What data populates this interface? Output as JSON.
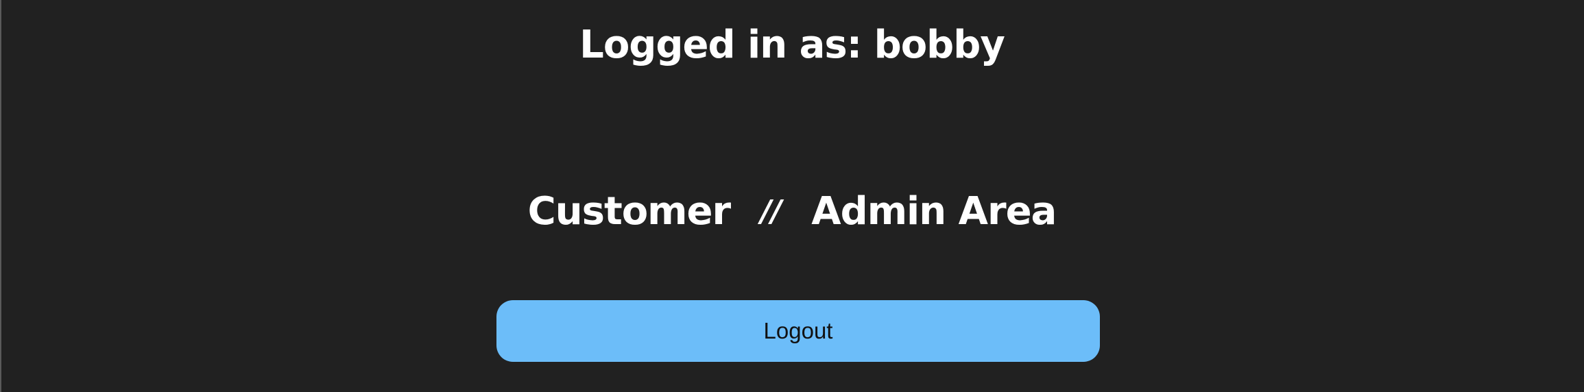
{
  "header": {
    "logged_in_text": "Logged in as: bobby"
  },
  "nav": {
    "customer_label": "Customer",
    "separator": "//",
    "admin_label": "Admin Area"
  },
  "actions": {
    "logout_label": "Logout"
  },
  "colors": {
    "background": "#212121",
    "button": "#6cbdf9",
    "text": "#ffffff"
  }
}
